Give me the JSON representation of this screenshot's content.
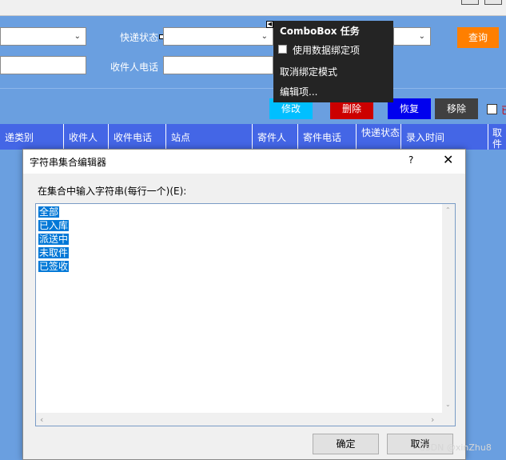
{
  "form": {
    "labels": {
      "express_status": "快递状态",
      "receiver_phone": "收件人电话"
    },
    "buttons": {
      "query": "查询",
      "modify": "修改",
      "delete": "删除",
      "restore": "恢复",
      "remove": "移除",
      "checkbox_label": "已"
    },
    "grid_headers": [
      "递类别",
      "收件人",
      "收件电话",
      "站点",
      "寄件人",
      "寄件电话",
      "快递状态",
      "录入时间",
      "取件式"
    ]
  },
  "smart_tag": {
    "title": "ComboBox 任务",
    "use_binding": "使用数据绑定项",
    "unbind_mode": "取消绑定模式",
    "edit_items": "编辑项..."
  },
  "dialog": {
    "title": "字符串集合编辑器",
    "help": "?",
    "close": "✕",
    "prompt": "在集合中输入字符串(每行一个)(E):",
    "items": [
      "全部",
      "已入库",
      "派送中",
      "未取件",
      "已签收"
    ],
    "ok": "确定",
    "cancel": "取消"
  },
  "watermark": "CSDN @xinZhu8",
  "colors": {
    "form_bg": "#6a9fe0",
    "query_btn": "#ff7f00",
    "modify_btn": "#00bfff",
    "delete_btn": "#cc0000",
    "restore_btn": "#0000ee",
    "remove_btn": "#404040",
    "grid_header": "#4466e6",
    "selection": "#0078d7"
  },
  "icons": {
    "dropdown": "chevron-down-icon",
    "help": "question-icon",
    "close": "close-icon"
  }
}
